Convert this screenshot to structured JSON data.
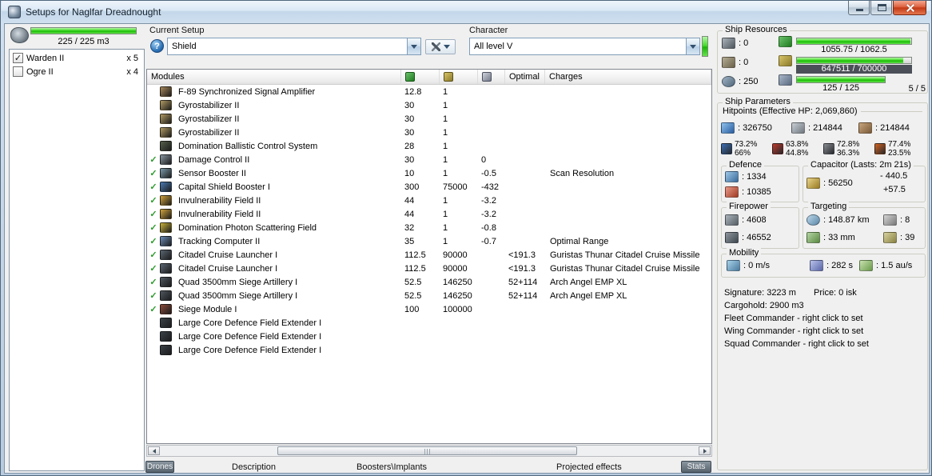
{
  "window": {
    "title": "Setups for Naglfar Dreadnought"
  },
  "drone_panel": {
    "capacity_text": "225 / 225 m3",
    "items": [
      {
        "name": "Warden II",
        "qty": "x 5",
        "checked": true
      },
      {
        "name": "Ogre II",
        "qty": "x 4",
        "checked": false
      }
    ]
  },
  "setup": {
    "label": "Current Setup",
    "value": "Shield",
    "help_glyph": "?"
  },
  "character": {
    "label": "Character",
    "value": "All level V"
  },
  "modules": {
    "headers": {
      "name": "Modules",
      "optimal": "Optimal",
      "charges": "Charges"
    },
    "rows": [
      {
        "active": false,
        "color": "#a8885a",
        "name": "F-89 Synchronized Signal Amplifier",
        "cpu": "12.8",
        "pg": "1",
        "cap": "",
        "optimal": "",
        "charges": ""
      },
      {
        "active": false,
        "color": "#b09a62",
        "name": "Gyrostabilizer II",
        "cpu": "30",
        "pg": "1",
        "cap": "",
        "optimal": "",
        "charges": ""
      },
      {
        "active": false,
        "color": "#b09a62",
        "name": "Gyrostabilizer II",
        "cpu": "30",
        "pg": "1",
        "cap": "",
        "optimal": "",
        "charges": ""
      },
      {
        "active": false,
        "color": "#b09a62",
        "name": "Gyrostabilizer II",
        "cpu": "30",
        "pg": "1",
        "cap": "",
        "optimal": "",
        "charges": ""
      },
      {
        "active": false,
        "color": "#56604a",
        "name": "Domination Ballistic Control System",
        "cpu": "28",
        "pg": "1",
        "cap": "",
        "optimal": "",
        "charges": ""
      },
      {
        "active": true,
        "color": "#8895a0",
        "name": "Damage Control II",
        "cpu": "30",
        "pg": "1",
        "cap": "0",
        "optimal": "",
        "charges": ""
      },
      {
        "active": true,
        "color": "#7a98a8",
        "name": "Sensor Booster II",
        "cpu": "10",
        "pg": "1",
        "cap": "-0.5",
        "optimal": "",
        "charges": "Scan Resolution"
      },
      {
        "active": true,
        "color": "#4a7ab0",
        "name": "Capital Shield Booster I",
        "cpu": "300",
        "pg": "75000",
        "cap": "-432",
        "optimal": "",
        "charges": ""
      },
      {
        "active": true,
        "color": "#d1a33c",
        "name": "Invulnerability Field II",
        "cpu": "44",
        "pg": "1",
        "cap": "-3.2",
        "optimal": "",
        "charges": ""
      },
      {
        "active": true,
        "color": "#d1a33c",
        "name": "Invulnerability Field II",
        "cpu": "44",
        "pg": "1",
        "cap": "-3.2",
        "optimal": "",
        "charges": ""
      },
      {
        "active": true,
        "color": "#c8b23a",
        "name": "Domination Photon Scattering Field",
        "cpu": "32",
        "pg": "1",
        "cap": "-0.8",
        "optimal": "",
        "charges": ""
      },
      {
        "active": true,
        "color": "#6a8ab5",
        "name": "Tracking Computer II",
        "cpu": "35",
        "pg": "1",
        "cap": "-0.7",
        "optimal": "",
        "charges": "Optimal Range"
      },
      {
        "active": true,
        "color": "#5a6570",
        "name": "Citadel Cruise Launcher I",
        "cpu": "112.5",
        "pg": "90000",
        "cap": "",
        "optimal": "<191.3",
        "charges": "Guristas Thunar Citadel Cruise Missile"
      },
      {
        "active": true,
        "color": "#5a6570",
        "name": "Citadel Cruise Launcher I",
        "cpu": "112.5",
        "pg": "90000",
        "cap": "",
        "optimal": "<191.3",
        "charges": "Guristas Thunar Citadel Cruise Missile"
      },
      {
        "active": true,
        "color": "#4e565e",
        "name": "Quad 3500mm Siege Artillery I",
        "cpu": "52.5",
        "pg": "146250",
        "cap": "",
        "optimal": "52+114",
        "charges": "Arch Angel EMP XL"
      },
      {
        "active": true,
        "color": "#4e565e",
        "name": "Quad 3500mm Siege Artillery I",
        "cpu": "52.5",
        "pg": "146250",
        "cap": "",
        "optimal": "52+114",
        "charges": "Arch Angel EMP XL"
      },
      {
        "active": true,
        "color": "#8a4a3a",
        "name": "Siege Module I",
        "cpu": "100",
        "pg": "100000",
        "cap": "",
        "optimal": "",
        "charges": ""
      },
      {
        "active": false,
        "color": "#3a4148",
        "name": "Large Core Defence Field Extender I",
        "cpu": "",
        "pg": "",
        "cap": "",
        "optimal": "",
        "charges": ""
      },
      {
        "active": false,
        "color": "#3a4148",
        "name": "Large Core Defence Field Extender I",
        "cpu": "",
        "pg": "",
        "cap": "",
        "optimal": "",
        "charges": ""
      },
      {
        "active": false,
        "color": "#3a4148",
        "name": "Large Core Defence Field Extender I",
        "cpu": "",
        "pg": "",
        "cap": "",
        "optimal": "",
        "charges": ""
      }
    ]
  },
  "bottom_bar": {
    "drones": "Drones",
    "description": "Description",
    "boosters": "Boosters\\Implants",
    "projected": "Projected effects",
    "stats": "Stats"
  },
  "ship_resources": {
    "title": "Ship Resources",
    "turret_hardpoints": ": 0",
    "launcher_hardpoints": ": 0",
    "calibration": ": 250",
    "cpu_text": "1055.75 / 1062.5",
    "powergrid_text": "647511 / 700000",
    "drone_bandwidth_text": "125 / 125",
    "drones_count": "5 / 5"
  },
  "ship_parameters": {
    "title": "Ship Parameters",
    "hitpoints_label": "Hitpoints (Effective HP: 2,069,860)",
    "shield_hp": ": 326750",
    "armor_hp": ": 214844",
    "hull_hp": ": 214844",
    "resists": [
      {
        "icon": "em-resist-icon",
        "color": "#3d6fb4",
        "shield": "73.2%",
        "armor": "66%"
      },
      {
        "icon": "thermal-resist-icon",
        "color": "#c03a2b",
        "shield": "63.8%",
        "armor": "44.8%"
      },
      {
        "icon": "kinetic-resist-icon",
        "color": "#8a8f94",
        "shield": "72.8%",
        "armor": "36.3%"
      },
      {
        "icon": "explosive-resist-icon",
        "color": "#d3641e",
        "shield": "77.4%",
        "armor": "23.5%"
      }
    ],
    "defence": {
      "title": "Defence",
      "shield_recharge": ": 1334",
      "tank": ": 10385"
    },
    "capacitor": {
      "title": "Capacitor (Lasts: 2m 21s)",
      "amount": ": 56250",
      "drain": "- 440.5",
      "recharge": "+57.5"
    },
    "firepower": {
      "title": "Firepower",
      "dps": ": 4608",
      "volley": ": 46552"
    },
    "targeting": {
      "title": "Targeting",
      "range": ": 148.87 km",
      "max_targets": ": 8",
      "scan_resolution": ": 33 mm",
      "sensor_strength": ": 39"
    },
    "mobility": {
      "title": "Mobility",
      "speed": ": 0 m/s",
      "align": ": 282 s",
      "warp": ": 1.5 au/s"
    },
    "info": {
      "signature": "Signature: 3223 m",
      "price": "Price: 0 isk",
      "cargohold": "Cargohold: 2900 m3",
      "fleet": "Fleet Commander - right click to set",
      "wing": "Wing Commander - right click to set",
      "squad": "Squad Commander - right click to set"
    }
  }
}
